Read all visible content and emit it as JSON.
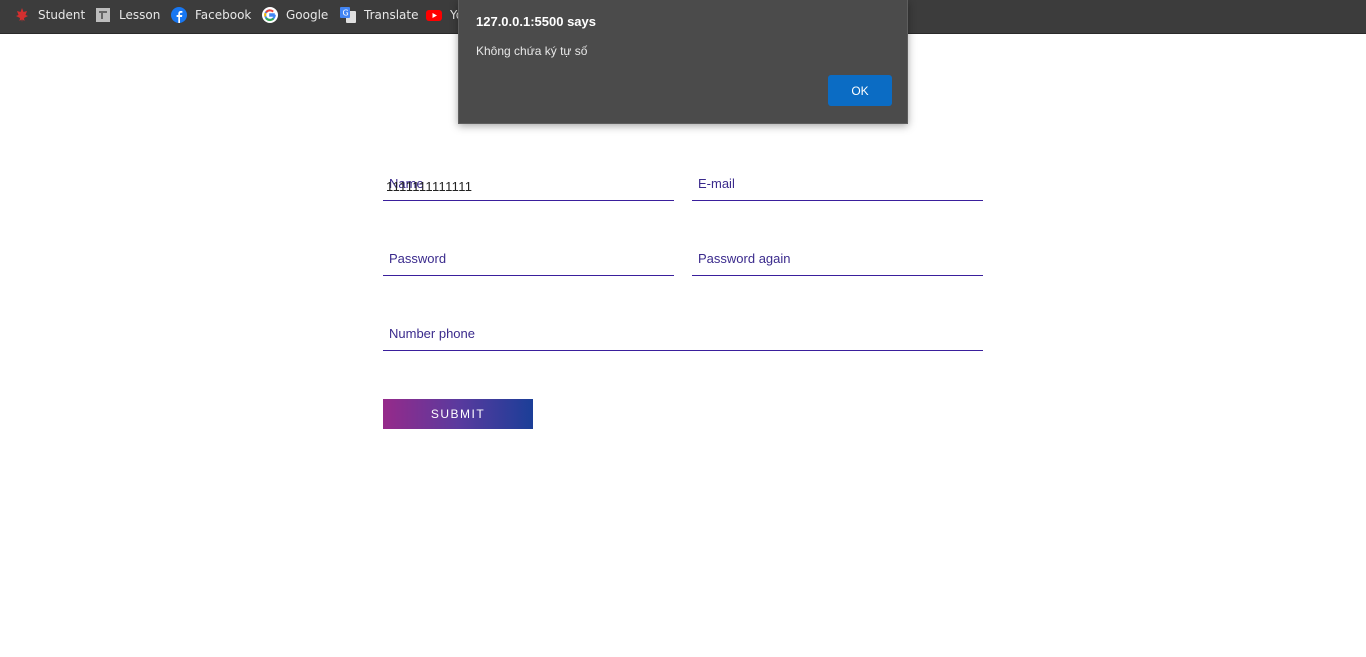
{
  "bookmarks": [
    {
      "label": "Student",
      "icon": "maple-leaf-icon"
    },
    {
      "label": "Lesson",
      "icon": "document-icon"
    },
    {
      "label": "Facebook",
      "icon": "facebook-icon"
    },
    {
      "label": "Google",
      "icon": "google-icon"
    },
    {
      "label": "Translate",
      "icon": "translate-icon"
    },
    {
      "label": "Yo",
      "icon": "youtube-icon"
    }
  ],
  "form": {
    "name": {
      "label": "Name",
      "value": "1111111111111"
    },
    "email": {
      "label": "E-mail"
    },
    "password": {
      "label": "Password"
    },
    "password_again": {
      "label": "Password again"
    },
    "phone": {
      "label": "Number phone"
    },
    "submit_label": "SUBMIT"
  },
  "dialog": {
    "title": "127.0.0.1:5500 says",
    "message": "Không chứa ký tự số",
    "ok_label": "OK"
  },
  "colors": {
    "bookmark_bar": "#3c3c3c",
    "field_underline": "#3a1f9c",
    "submit_gradient_start": "#962a8a",
    "submit_gradient_end": "#1b3e98",
    "dialog_bg": "#4b4b4b",
    "ok_button": "#0b6cc4"
  }
}
